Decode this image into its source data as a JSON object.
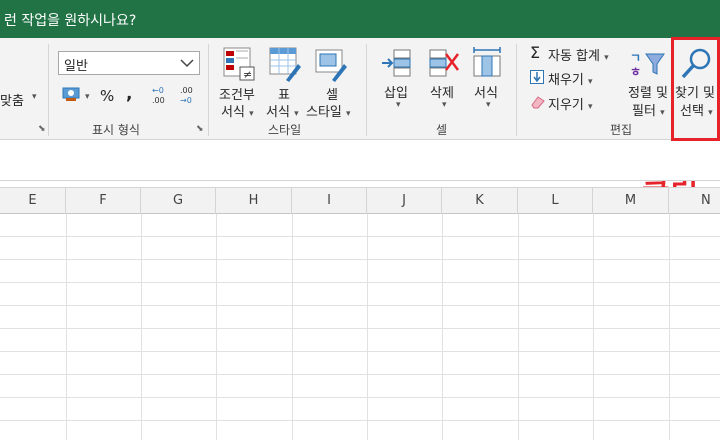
{
  "titlebar": {
    "tell_me": "런 작업을 원하시나요?"
  },
  "alignment": {
    "merge_label": "맞춤",
    "caret": "▾"
  },
  "number": {
    "format_value": "일반",
    "percent": "%",
    "comma": ",",
    "group_label": "표시 형식"
  },
  "styles": {
    "conditional_l1": "조건부",
    "conditional_l2": "서식",
    "table_l1": "표",
    "table_l2": "서식",
    "cell_l1": "셀",
    "cell_l2": "스타일",
    "group_label": "스타일"
  },
  "cells": {
    "insert": "삽입",
    "delete": "삭제",
    "format": "서식",
    "group_label": "셀"
  },
  "editing": {
    "autosum": "자동 합계",
    "fill": "채우기",
    "clear": "지우기",
    "sort_l1": "정렬 및",
    "sort_l2": "필터",
    "find_l1": "찾기 및",
    "find_l2": "선택",
    "group_label": "편집"
  },
  "annotation": {
    "click_text": "클릭",
    "color": "#e6232b"
  },
  "columns": [
    "E",
    "F",
    "G",
    "H",
    "I",
    "J",
    "K",
    "L",
    "M",
    "N"
  ],
  "theme": {
    "excel_green": "#217346"
  }
}
